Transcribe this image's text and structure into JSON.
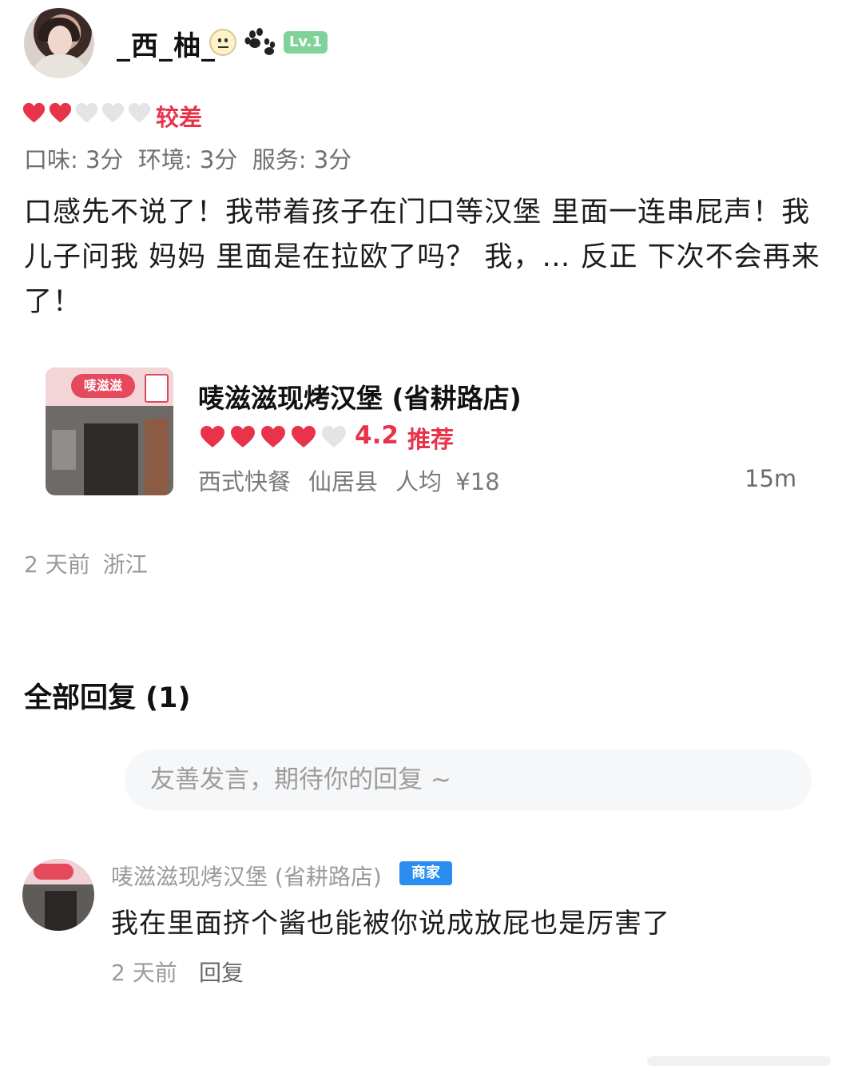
{
  "user": {
    "name": "_西_柚_",
    "level": "Lv.1"
  },
  "review": {
    "hearts_filled": 2,
    "hearts_total": 5,
    "rating_label": "较差",
    "scores_text": "口味: 3分  环境: 3分  服务: 3分",
    "text": "口感先不说了！我带着孩子在门口等汉堡  里面一连串屁声！我儿子问我 妈妈 里面是在拉欧了吗？ 我，… 反正 下次不会再来了！"
  },
  "shop": {
    "name": "唛滋滋现烤汉堡 (省耕路店)",
    "sign_text": "唛滋滋",
    "hearts_filled": 4,
    "hearts_total": 5,
    "score": "4.2",
    "tag": "推荐",
    "category": "西式快餐",
    "area": "仙居县",
    "price": "人均 ¥18",
    "distance": "15m"
  },
  "post_meta": {
    "time": "2 天前",
    "location": "浙江"
  },
  "replies_section": {
    "heading": "全部回复 (1)",
    "input_placeholder": "友善发言，期待你的回复 ~"
  },
  "reply": {
    "author": "唛滋滋现烤汉堡 (省耕路店)",
    "badge": "商家",
    "text": "我在里面挤个酱也能被你说成放屁也是厉害了",
    "time": "2 天前",
    "action": "回复"
  },
  "colors": {
    "accent_red": "#e8334a",
    "heart_empty": "#e4e4e4",
    "level_badge": "#7fd39a",
    "merchant_badge": "#2a8df0"
  }
}
